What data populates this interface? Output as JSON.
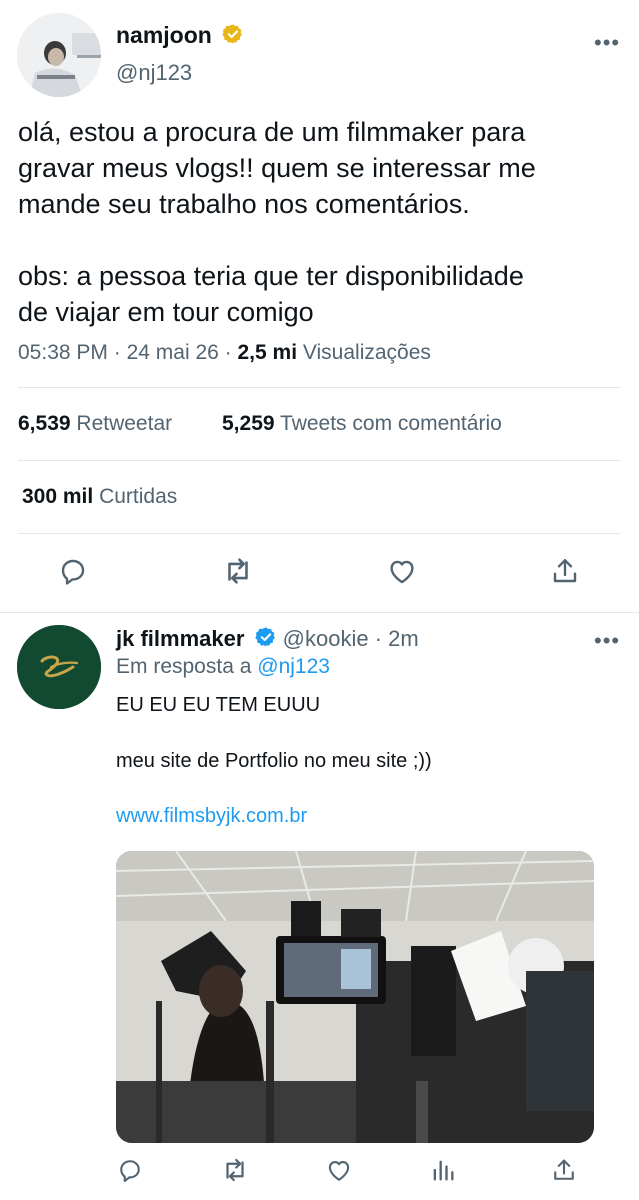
{
  "tweet": {
    "author_name": "namjoon",
    "author_handle": "@nj123",
    "more_label": "•••",
    "text": "olá, estou a procura de um filmmaker para\ngravar meus vlogs!! quem se interessar me\nmande seu trabalho nos comentários.\n\nobs: a pessoa teria que ter disponibilidade\nde viajar em tour comigo",
    "time": "05:38 PM",
    "date": "24 mai 26",
    "sep": "·",
    "views_count": "2,5 mi",
    "views_label": "Visualizações",
    "retweets_count": "6,539",
    "retweets_label": "Retweetar",
    "quotes_count": "5,259",
    "quotes_label": "Tweets com comentário",
    "likes_count": "300 mil",
    "likes_label": "Curtidas"
  },
  "reply": {
    "author_name": "jk filmmaker",
    "author_handle": "@kookie",
    "time": "2m",
    "sep": "·",
    "more_label": "•••",
    "reply_prefix": "Em resposta a",
    "reply_to": "@nj123",
    "line1": "EU EU EU TEM EUUU",
    "line2": "meu site de Portfolio no meu site ;))",
    "link": "www.filmsbyjk.com.br"
  },
  "colors": {
    "accent": "#1d9bf0",
    "verified_gold": "#e8b619",
    "avatar_green": "#114a30",
    "secondary_text": "#536471"
  },
  "icons": [
    "verified-gold-icon",
    "verified-blue-icon",
    "reply-icon",
    "retweet-icon",
    "like-icon",
    "share-icon",
    "views-icon",
    "more-icon"
  ]
}
